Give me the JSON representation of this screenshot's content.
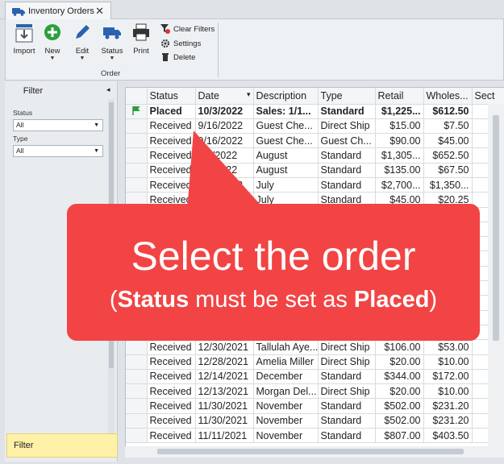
{
  "tab": {
    "title": "Inventory Orders",
    "close": "✕"
  },
  "ribbon": {
    "import": "Import",
    "new": "New",
    "edit": "Edit",
    "status": "Status",
    "print": "Print",
    "clear_filters": "Clear Filters",
    "settings": "Settings",
    "delete": "Delete",
    "group_label": "Order"
  },
  "filter_panel": {
    "title": "Filter",
    "collapse": "◂",
    "status_label": "Status",
    "status_value": "All",
    "type_label": "Type",
    "type_value": "All",
    "footer": "Filter"
  },
  "grid": {
    "columns": [
      "Status",
      "Date",
      "Description",
      "Type",
      "Retail",
      "Wholes...",
      "Sect"
    ],
    "date_sort_indicator": "▾",
    "rows": [
      [
        "Placed",
        "10/3/2022",
        "Sales: 1/1...",
        "Standard",
        "$1,225...",
        "$612.50",
        ""
      ],
      [
        "Received",
        "9/16/2022",
        "Guest Che...",
        "Direct Ship",
        "$15.00",
        "$7.50",
        ""
      ],
      [
        "Received",
        "9/16/2022",
        "Guest Che...",
        "Guest Ch...",
        "$90.00",
        "$45.00",
        ""
      ],
      [
        "Received",
        "8/5/2022",
        "August",
        "Standard",
        "$1,305...",
        "$652.50",
        ""
      ],
      [
        "Received",
        "8/5/2022",
        "August",
        "Standard",
        "$135.00",
        "$67.50",
        ""
      ],
      [
        "Received",
        "7/27/2022",
        "July",
        "Standard",
        "$2,700...",
        "$1,350...",
        ""
      ],
      [
        "Received",
        "7/15/2022",
        "July",
        "Standard",
        "$45.00",
        "$20.25",
        ""
      ],
      [
        "",
        "",
        "",
        "",
        "",
        "",
        ""
      ],
      [
        "",
        "",
        "",
        "",
        "",
        "",
        ""
      ],
      [
        "",
        "",
        "",
        "",
        "",
        "",
        ""
      ],
      [
        "",
        "",
        "",
        "",
        "",
        "",
        ""
      ],
      [
        "",
        "",
        "",
        "",
        "",
        "",
        ""
      ],
      [
        "",
        "",
        "",
        "",
        "",
        "",
        ""
      ],
      [
        "",
        "",
        "",
        "",
        "",
        "",
        ""
      ],
      [
        "",
        "",
        "",
        "",
        "",
        "",
        ""
      ],
      [
        "",
        "",
        "",
        "",
        "",
        "",
        ""
      ],
      [
        "Received",
        "12/30/2021",
        "Tallulah Aye...",
        "Direct Ship",
        "$106.00",
        "$53.00",
        ""
      ],
      [
        "Received",
        "12/28/2021",
        "Amelia Miller",
        "Direct Ship",
        "$20.00",
        "$10.00",
        ""
      ],
      [
        "Received",
        "12/14/2021",
        "December",
        "Standard",
        "$344.00",
        "$172.00",
        ""
      ],
      [
        "Received",
        "12/13/2021",
        "Morgan Del...",
        "Direct Ship",
        "$20.00",
        "$10.00",
        ""
      ],
      [
        "Received",
        "11/30/2021",
        "November",
        "Standard",
        "$502.00",
        "$231.20",
        ""
      ],
      [
        "Received",
        "11/30/2021",
        "November",
        "Standard",
        "$502.00",
        "$231.20",
        ""
      ],
      [
        "Received",
        "11/11/2021",
        "November",
        "Standard",
        "$807.00",
        "$403.50",
        ""
      ]
    ]
  },
  "callout": {
    "headline": "Select the order",
    "open_paren": "(",
    "status_word": "Status",
    "mid_text": " must be set as ",
    "placed_word": "Placed",
    "close_paren": ")"
  },
  "colors": {
    "callout": "#f24444",
    "flag": "#2e9e3a",
    "accent": "#2a62b0",
    "filter_footer": "#fff2a8"
  }
}
